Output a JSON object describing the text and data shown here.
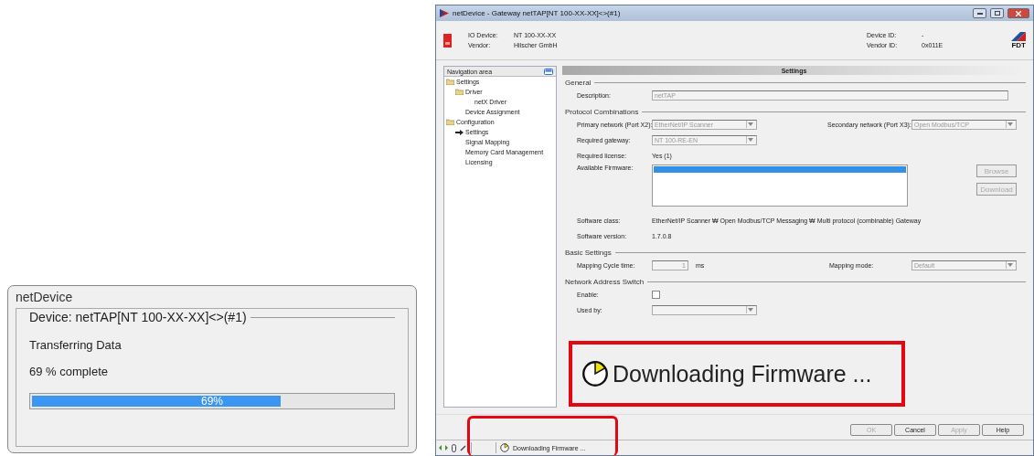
{
  "progress_dialog": {
    "title": "netDevice",
    "group_label": "Device: netTAP[NT 100-XX-XX]<>(#1)",
    "status": "Transferring Data",
    "percent_text": "69 % complete",
    "level": 0.69,
    "bar_label": "69%"
  },
  "main_window": {
    "title": "netDevice - Gateway netTAP[NT 100-XX-XX]<>(#1)",
    "header": [
      {
        "label": "IO Device:",
        "value": "NT 100-XX-XX"
      },
      {
        "label": "Vendor:",
        "value": "Hilscher GmbH"
      },
      {
        "label": "Device ID:",
        "value": "-"
      },
      {
        "label": "Vendor ID:",
        "value": "0x011E"
      }
    ],
    "logo_text": "FDT",
    "navigation": {
      "title": "Navigation area",
      "items": [
        {
          "label": "Settings",
          "selected": false,
          "children": [
            {
              "label": "Driver",
              "selected": false,
              "children": [
                {
                  "label": "netX Driver",
                  "selected": false
                }
              ]
            },
            {
              "label": "Device Assignment",
              "selected": false
            }
          ]
        },
        {
          "label": "Configuration",
          "selected": false,
          "children": [
            {
              "label": "Settings",
              "selected": true
            },
            {
              "label": "Signal Mapping",
              "selected": false
            },
            {
              "label": "Memory Card Management",
              "selected": false
            },
            {
              "label": "Licensing",
              "selected": false
            }
          ]
        }
      ]
    },
    "settings": {
      "title": "Settings",
      "sections": [
        {
          "title": "General",
          "rows": [
            [
              {
                "kind": "input",
                "label": "Description:",
                "value": "netTAP"
              }
            ]
          ]
        },
        {
          "title": "Protocol Combinations",
          "rows": [
            [
              {
                "kind": "select",
                "label": "Primary network (Port X2):",
                "value": "EtherNet/IP Scanner"
              },
              {
                "kind": "select",
                "label": "Secondary network (Port X3):",
                "value": "Open Modbus/TCP"
              }
            ],
            [
              {
                "kind": "select",
                "label": "Required gateway:",
                "value": "NT 100-RE-EN"
              }
            ],
            [
              {
                "kind": "text",
                "label": "Required license:",
                "value": "Yes (1)"
              }
            ],
            [
              {
                "kind": "list",
                "label": "Available Firmware:",
                "buttons": [
                  {
                    "label": "Browse",
                    "disabled": true
                  },
                  {
                    "label": "Download",
                    "disabled": true
                  }
                ]
              }
            ],
            [
              {
                "kind": "text",
                "label": "Software class:",
                "value": "EtherNet/IP Scanner ₩ Open Modbus/TCP Messaging ₩ Multi protocol (combinable) Gateway"
              }
            ],
            [
              {
                "kind": "text",
                "label": "Software version:",
                "value": "1.7.0.8"
              }
            ]
          ]
        },
        {
          "title": "Basic Settings",
          "rows": [
            [
              {
                "kind": "input",
                "label": "Mapping Cycle time:",
                "value": "1",
                "unit": "ms"
              },
              {
                "kind": "select",
                "label": "Mapping mode:",
                "value": "Default"
              }
            ]
          ]
        },
        {
          "title": "Network Address Switch",
          "rows": [
            [
              {
                "kind": "checkbox",
                "label": "Enable:",
                "checked": false
              }
            ],
            [
              {
                "kind": "select",
                "label": "Used by:"
              }
            ]
          ]
        }
      ]
    },
    "buttons": [
      {
        "label": "OK",
        "disabled": true
      },
      {
        "label": "Cancel",
        "disabled": false
      },
      {
        "label": "Apply",
        "disabled": true
      },
      {
        "label": "Help",
        "disabled": false
      }
    ],
    "status_bar": {
      "text": "Downloading Firmware ..."
    }
  },
  "callout": {
    "text": "Downloading Firmware ..."
  }
}
